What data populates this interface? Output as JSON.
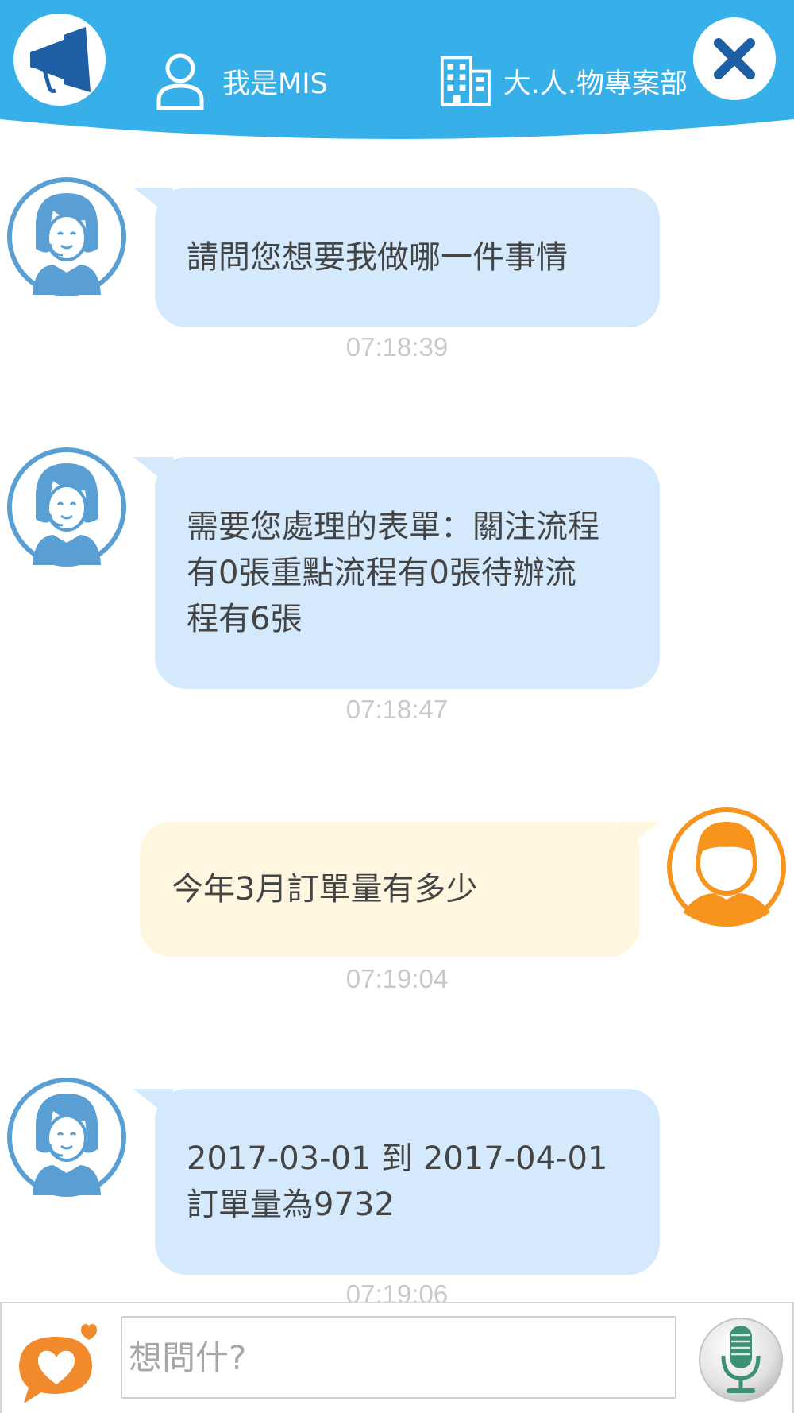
{
  "header": {
    "user_label": "我是MIS",
    "company_label": "大.人.物專案部"
  },
  "messages": [
    {
      "sender": "bot",
      "text": "請問您想要我做哪一件事情",
      "time": "07:18:39"
    },
    {
      "sender": "bot",
      "text": "需要您處理的表單：關注流程\n有0張重點流程有0張待辦流\n程有6張",
      "time": "07:18:47"
    },
    {
      "sender": "user",
      "text": "今年3月訂單量有多少",
      "time": "07:19:04"
    },
    {
      "sender": "bot",
      "text": " 2017-03-01 到 2017-04-01\n訂單量為9732",
      "time": "07:19:06"
    }
  ],
  "input": {
    "placeholder": "想問什?",
    "value": ""
  },
  "colors": {
    "header_blue": "#37afe8",
    "bot_bubble": "#d5e9fc",
    "user_bubble": "#fff6df",
    "bot_avatar": "#5a9fd4",
    "user_avatar": "#f7941e",
    "close_x": "#1f5fa6",
    "mic_green": "#3d8f76"
  },
  "icons": {
    "announce": "megaphone-icon",
    "user": "user-outline-icon",
    "company": "building-icon",
    "close": "close-icon",
    "bot_avatar": "support-agent-avatar-icon",
    "user_avatar": "user-avatar-icon",
    "favorite": "heart-chat-icon",
    "mic": "microphone-icon"
  }
}
